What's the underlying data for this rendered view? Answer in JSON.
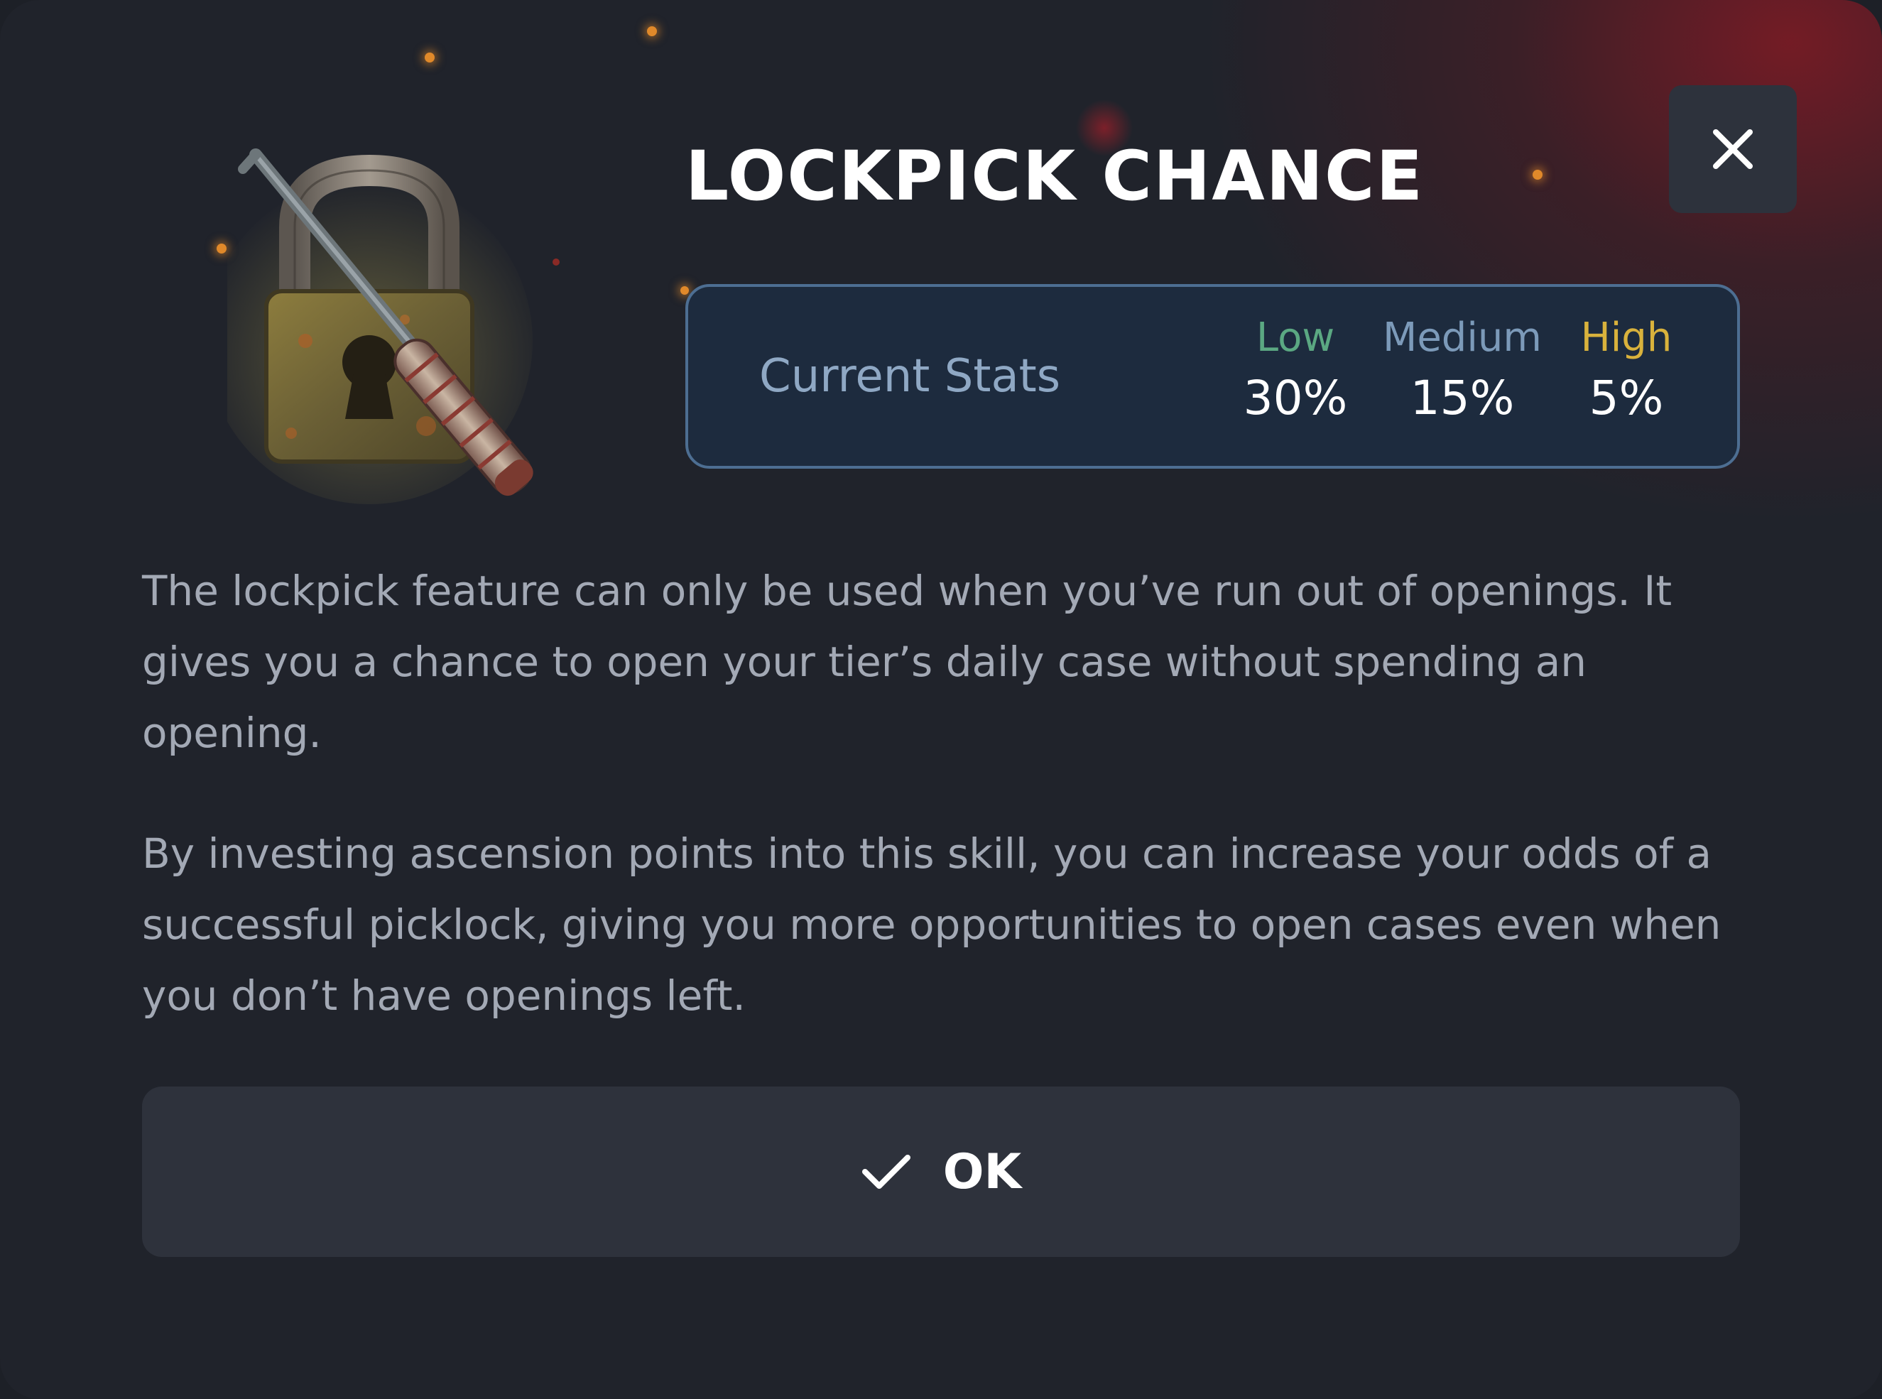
{
  "dialog": {
    "title": "LOCKPICK CHANCE",
    "close_icon": "close-icon",
    "illustration_icon": "padlock-with-lockpick-icon"
  },
  "stats": {
    "label": "Current Stats",
    "levels": [
      {
        "name": "Low",
        "value": "30%",
        "color": "#5ba882"
      },
      {
        "name": "Medium",
        "value": "15%",
        "color": "#7c9ab9"
      },
      {
        "name": "High",
        "value": "5%",
        "color": "#d9b23c"
      }
    ]
  },
  "description": {
    "paragraph_1": "The lockpick feature can only be used when you’ve run out of openings. It gives you a chance to open your tier’s daily case without spending an opening.",
    "paragraph_2": "By investing ascension points into this skill, you can increase your odds of a successful picklock, giving you more opportunities to open cases even when you don’t have openings left."
  },
  "actions": {
    "ok_label": "OK",
    "ok_icon": "checkmark-icon"
  },
  "colors": {
    "accent_red": "#821a24",
    "background": "#20232b",
    "stats_border": "#4d6e92",
    "stats_background": "#1d2b3e",
    "button_background": "#2e323c"
  }
}
